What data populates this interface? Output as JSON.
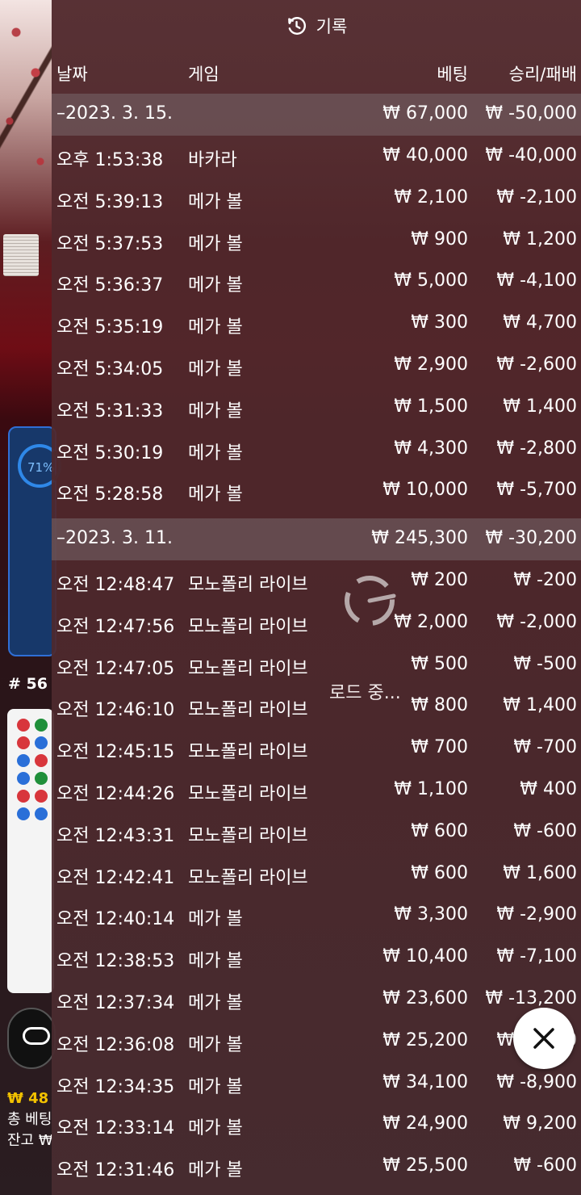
{
  "header": {
    "title": "기록",
    "icon": "history-icon"
  },
  "columns": {
    "date": "날짜",
    "game": "게임",
    "bet": "베팅",
    "result": "승리/패배"
  },
  "groups": [
    {
      "date": "–2023. 3. 15.",
      "bet_total": "₩ 67,000",
      "result_total": "₩ -50,000",
      "rows": [
        {
          "time": "오후 1:53:38",
          "game": "바카라",
          "bet": "₩ 40,000",
          "result": "₩ -40,000"
        },
        {
          "time": "오전 5:39:13",
          "game": "메가 볼",
          "bet": "₩ 2,100",
          "result": "₩ -2,100"
        },
        {
          "time": "오전 5:37:53",
          "game": "메가 볼",
          "bet": "₩ 900",
          "result": "₩ 1,200"
        },
        {
          "time": "오전 5:36:37",
          "game": "메가 볼",
          "bet": "₩ 5,000",
          "result": "₩ -4,100"
        },
        {
          "time": "오전 5:35:19",
          "game": "메가 볼",
          "bet": "₩ 300",
          "result": "₩ 4,700"
        },
        {
          "time": "오전 5:34:05",
          "game": "메가 볼",
          "bet": "₩ 2,900",
          "result": "₩ -2,600"
        },
        {
          "time": "오전 5:31:33",
          "game": "메가 볼",
          "bet": "₩ 1,500",
          "result": "₩ 1,400"
        },
        {
          "time": "오전 5:30:19",
          "game": "메가 볼",
          "bet": "₩ 4,300",
          "result": "₩ -2,800"
        },
        {
          "time": "오전 5:28:58",
          "game": "메가 볼",
          "bet": "₩ 10,000",
          "result": "₩ -5,700"
        }
      ]
    },
    {
      "date": "–2023. 3. 11.",
      "bet_total": "₩ 245,300",
      "result_total": "₩ -30,200",
      "rows": [
        {
          "time": "오전 12:48:47",
          "game": "모노폴리 라이브",
          "bet": "₩ 200",
          "result": "₩ -200"
        },
        {
          "time": "오전 12:47:56",
          "game": "모노폴리 라이브",
          "bet": "₩ 2,000",
          "result": "₩ -2,000"
        },
        {
          "time": "오전 12:47:05",
          "game": "모노폴리 라이브",
          "bet": "₩ 500",
          "result": "₩ -500"
        },
        {
          "time": "오전 12:46:10",
          "game": "모노폴리 라이브",
          "bet": "₩ 800",
          "result": "₩ 1,400"
        },
        {
          "time": "오전 12:45:15",
          "game": "모노폴리 라이브",
          "bet": "₩ 700",
          "result": "₩ -700"
        },
        {
          "time": "오전 12:44:26",
          "game": "모노폴리 라이브",
          "bet": "₩ 1,100",
          "result": "₩ 400"
        },
        {
          "time": "오전 12:43:31",
          "game": "모노폴리 라이브",
          "bet": "₩ 600",
          "result": "₩ -600"
        },
        {
          "time": "오전 12:42:41",
          "game": "모노폴리 라이브",
          "bet": "₩ 600",
          "result": "₩ 1,600"
        },
        {
          "time": "오전 12:40:14",
          "game": "메가 볼",
          "bet": "₩ 3,300",
          "result": "₩ -2,900"
        },
        {
          "time": "오전 12:38:53",
          "game": "메가 볼",
          "bet": "₩ 10,400",
          "result": "₩ -7,100"
        },
        {
          "time": "오전 12:37:34",
          "game": "메가 볼",
          "bet": "₩ 23,600",
          "result": "₩ -13,200"
        },
        {
          "time": "오전 12:36:08",
          "game": "메가 볼",
          "bet": "₩ 25,200",
          "result": "₩ -7,000"
        },
        {
          "time": "오전 12:34:35",
          "game": "메가 볼",
          "bet": "₩ 34,100",
          "result": "₩ -8,900"
        },
        {
          "time": "오전 12:33:14",
          "game": "메가 볼",
          "bet": "₩ 24,900",
          "result": "₩ 9,200"
        },
        {
          "time": "오전 12:31:46",
          "game": "메가 볼",
          "bet": "₩ 25,500",
          "result": "₩ -600"
        }
      ]
    }
  ],
  "loading_text": "로드 중...",
  "background": {
    "progress_percent": "71%",
    "shoe_number": "# 56",
    "balance_line1": "₩ 48",
    "balance_line2": "총 베팅",
    "balance_line3": "잔고 ₩",
    "colors": {
      "yellow": "#f2c200",
      "blue_panel": "#17386a",
      "red": "#d8363c",
      "blue": "#2a6fd8"
    }
  },
  "close": {
    "icon": "close-icon"
  }
}
